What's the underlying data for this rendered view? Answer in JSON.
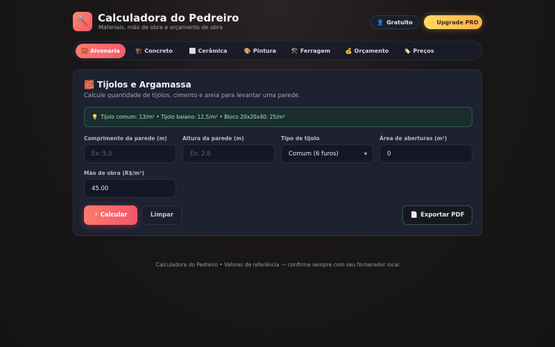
{
  "header": {
    "logo_icon": "🔨",
    "title": "Calculadora do Pedreiro",
    "subtitle": "Materiais, mão de obra e orçamento de obra",
    "free_icon": "👤",
    "free_label": "Gratuito",
    "pro_icon": "⭐",
    "pro_label": "Upgrade PRO"
  },
  "tabs": [
    {
      "icon": "🧱",
      "label": "Alvenaria",
      "active": true
    },
    {
      "icon": "🏗️",
      "label": "Concreto"
    },
    {
      "icon": "⬜",
      "label": "Cerâmica"
    },
    {
      "icon": "🎨",
      "label": "Pintura"
    },
    {
      "icon": "⚒️",
      "label": "Ferragem"
    },
    {
      "icon": "💰",
      "label": "Orçamento"
    },
    {
      "icon": "🏷️",
      "label": "Preços"
    }
  ],
  "card": {
    "title_icon": "🧱",
    "title": "Tijolos e Argamassa",
    "subtitle": "Calcule quantidade de tijolos, cimento e areia para levantar uma parede.",
    "info_icon": "💡",
    "info": "Tijolo comum: 13/m² • Tijolo baiano: 12,5/m² • Bloco 20x20x40: 25/m²"
  },
  "form": {
    "length": {
      "label": "Comprimento da parede (m)",
      "placeholder": "Ex: 5.0",
      "value": ""
    },
    "height": {
      "label": "Altura da parede (m)",
      "placeholder": "Ex: 2.8",
      "value": ""
    },
    "brick_type": {
      "label": "Tipo de tijolo",
      "selected": "Comum (6 furos)"
    },
    "openings": {
      "label": "Área de aberturas (m²)",
      "value": "0"
    },
    "labor": {
      "label": "Mão de obra (R$/m²)",
      "value": "45.00"
    }
  },
  "actions": {
    "calc_icon": "⚡",
    "calc_label": "Calcular",
    "clear_label": "Limpar",
    "pdf_icon": "📄",
    "pdf_label": "Exportar PDF"
  },
  "footer": "Calculadora do Pedreiro • Valores de referência — confirme sempre com seu fornecedor local"
}
